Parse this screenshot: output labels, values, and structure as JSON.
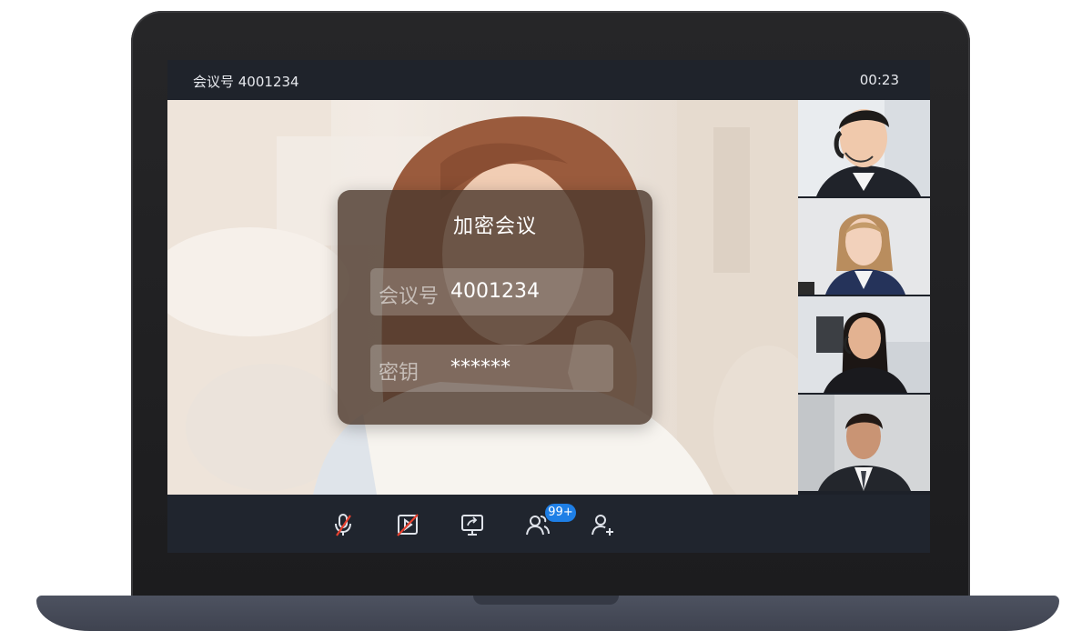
{
  "meeting": {
    "id_label": "会议号 4001234",
    "timer": "00:23"
  },
  "dialog": {
    "title": "加密会议",
    "id_field": {
      "label": "会议号",
      "value": "4001234"
    },
    "key_field": {
      "label": "密钥",
      "value": "******"
    }
  },
  "toolbar": {
    "participants_badge": "99+",
    "icons": [
      "mic-muted-icon",
      "video-off-icon",
      "share-screen-icon",
      "participants-icon",
      "add-user-icon"
    ]
  },
  "colors": {
    "screen_bg": "#1d2129",
    "badge": "#1e7fe6",
    "mute_slash": "#e8412f"
  }
}
